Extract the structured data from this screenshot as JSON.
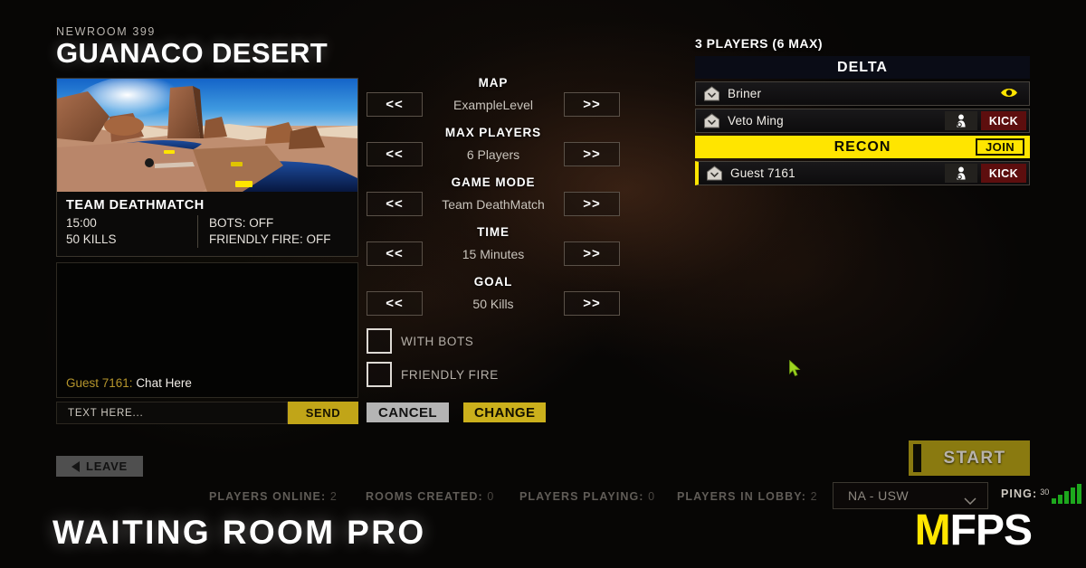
{
  "room": {
    "tag": "NEWROOM 399",
    "title": "GUANACO DESERT"
  },
  "map_card": {
    "mode": "TEAM DEATHMATCH",
    "time": "15:00",
    "goal": "50 KILLS",
    "bots": "BOTS: OFF",
    "friendly_fire": "FRIENDLY FIRE: OFF"
  },
  "chat": {
    "log": [
      {
        "user": "Guest 7161: ",
        "message": "Chat Here"
      }
    ],
    "input_placeholder": "TEXT HERE...",
    "send_label": "SEND"
  },
  "leave": {
    "label": "LEAVE"
  },
  "settings": {
    "prev_label": "<<",
    "next_label": ">>",
    "rows": [
      {
        "label": "MAP",
        "value": "ExampleLevel"
      },
      {
        "label": "MAX PLAYERS",
        "value": "6 Players"
      },
      {
        "label": "GAME MODE",
        "value": "Team DeathMatch"
      },
      {
        "label": "TIME",
        "value": "15 Minutes"
      },
      {
        "label": "GOAL",
        "value": "50 Kills"
      }
    ],
    "checkboxes": [
      {
        "label": "WITH BOTS",
        "checked": false
      },
      {
        "label": "FRIENDLY FIRE",
        "checked": false
      }
    ],
    "cancel_label": "CANCEL",
    "change_label": "CHANGE"
  },
  "players_panel": {
    "count_label": "3 PLAYERS (6 MAX)",
    "teams": [
      {
        "name": "DELTA",
        "active": false,
        "join_label": null,
        "players": [
          {
            "name": "Briner",
            "is_self": false,
            "action": "spectate",
            "kick_label": null
          },
          {
            "name": "Veto Ming",
            "is_self": false,
            "action": "kick",
            "kick_label": "KICK"
          }
        ]
      },
      {
        "name": "RECON",
        "active": true,
        "join_label": "JOIN",
        "players": [
          {
            "name": "Guest 7161",
            "is_self": true,
            "action": "kick",
            "kick_label": "KICK"
          }
        ]
      }
    ]
  },
  "start": {
    "label": "START"
  },
  "status": {
    "players_online_label": "PLAYERS ONLINE:",
    "players_online_value": "2",
    "rooms_created_label": "ROOMS CREATED:",
    "rooms_created_value": "0",
    "players_playing_label": "PLAYERS PLAYING:",
    "players_playing_value": "0",
    "players_in_lobby_label": "PLAYERS IN LOBBY:",
    "players_in_lobby_value": "2",
    "region": "NA - USW",
    "ping_label": "PING:",
    "ping_value": "30"
  },
  "footer": {
    "title": "WAITING ROOM PRO",
    "brand_m": "M",
    "brand_fps": "FPS"
  },
  "colors": {
    "accent_yellow": "#ffe500",
    "gold": "#cbb01c",
    "kick_red": "#5d0e0e",
    "start_olive": "#8a7a10",
    "ping_green": "#1da81d"
  }
}
